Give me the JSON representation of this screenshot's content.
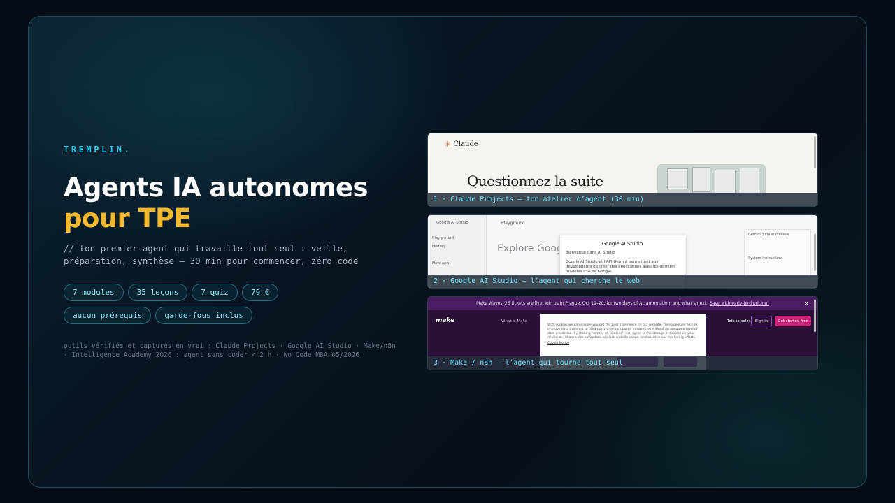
{
  "eyebrow": "TREMPLIN.",
  "title": {
    "line1": "Agents IA autonomes",
    "line2": "pour TPE"
  },
  "subtitle": "// ton premier agent qui travaille tout seul : veille, préparation, synthèse — 30 min pour commencer, zéro code",
  "chips": [
    "7 modules",
    "35 leçons",
    "7 quiz",
    "79 €",
    "aucun prérequis",
    "garde-fous inclus"
  ],
  "sources": "outils vérifiés et capturés en vrai : Claude Projects · Google AI Studio · Make/n8n · Intelligence Academy 2026 : agent sans coder < 2 h · No Code MBA 05/2026",
  "colors": {
    "accent": "#2ec7e6",
    "highlight": "#f6b82c",
    "background": "#060d17"
  },
  "cards": [
    {
      "caption": "1 · Claude Projects — ton atelier d’agent (30 min)",
      "logo": "Claude",
      "headline": "Questionnez la suite"
    },
    {
      "caption": "2 · Google AI Studio — l’agent qui cherche le web",
      "app_title": "Google AI Studio",
      "nav": [
        "Playground",
        "History",
        "New app"
      ],
      "tab": "Playground",
      "heading": "Explore Google",
      "modal_title": "Google AI Studio",
      "modal_greeting": "Bienvenue dans AI Studio",
      "modal_text": "Google AI Studio et l'API Gemini permettent aux développeurs de créer des applications avec les derniers modèles d'IA de Google.",
      "panel": [
        "Gemini 3 Flash Preview",
        "System instructions"
      ]
    },
    {
      "caption": "3 · Make / n8n — l’agent qui tourne tout seul",
      "banner": "Make Waves '26 tickets are live. Join us in Prague, Oct 19–20, for two days of AI, automation, and what's next.",
      "banner_link": "Save with early-bird pricing!",
      "logo": "make",
      "nav": "What is Make",
      "talk": "Talk to sales",
      "signin": "Sign in",
      "cta": "Get started free",
      "cookie_text": "With cookies we can ensure you get the best experience on our website. These cookies help to improve data transfers to third-party providers based in countries without an adequate level of data protection. By clicking \"Accept All Cookies\", you agree to the storage of cookies on your device to enhance site navigation, analyze website usage, and assist in our marketing efforts.",
      "cookie_link": "Cookie Notice"
    }
  ]
}
